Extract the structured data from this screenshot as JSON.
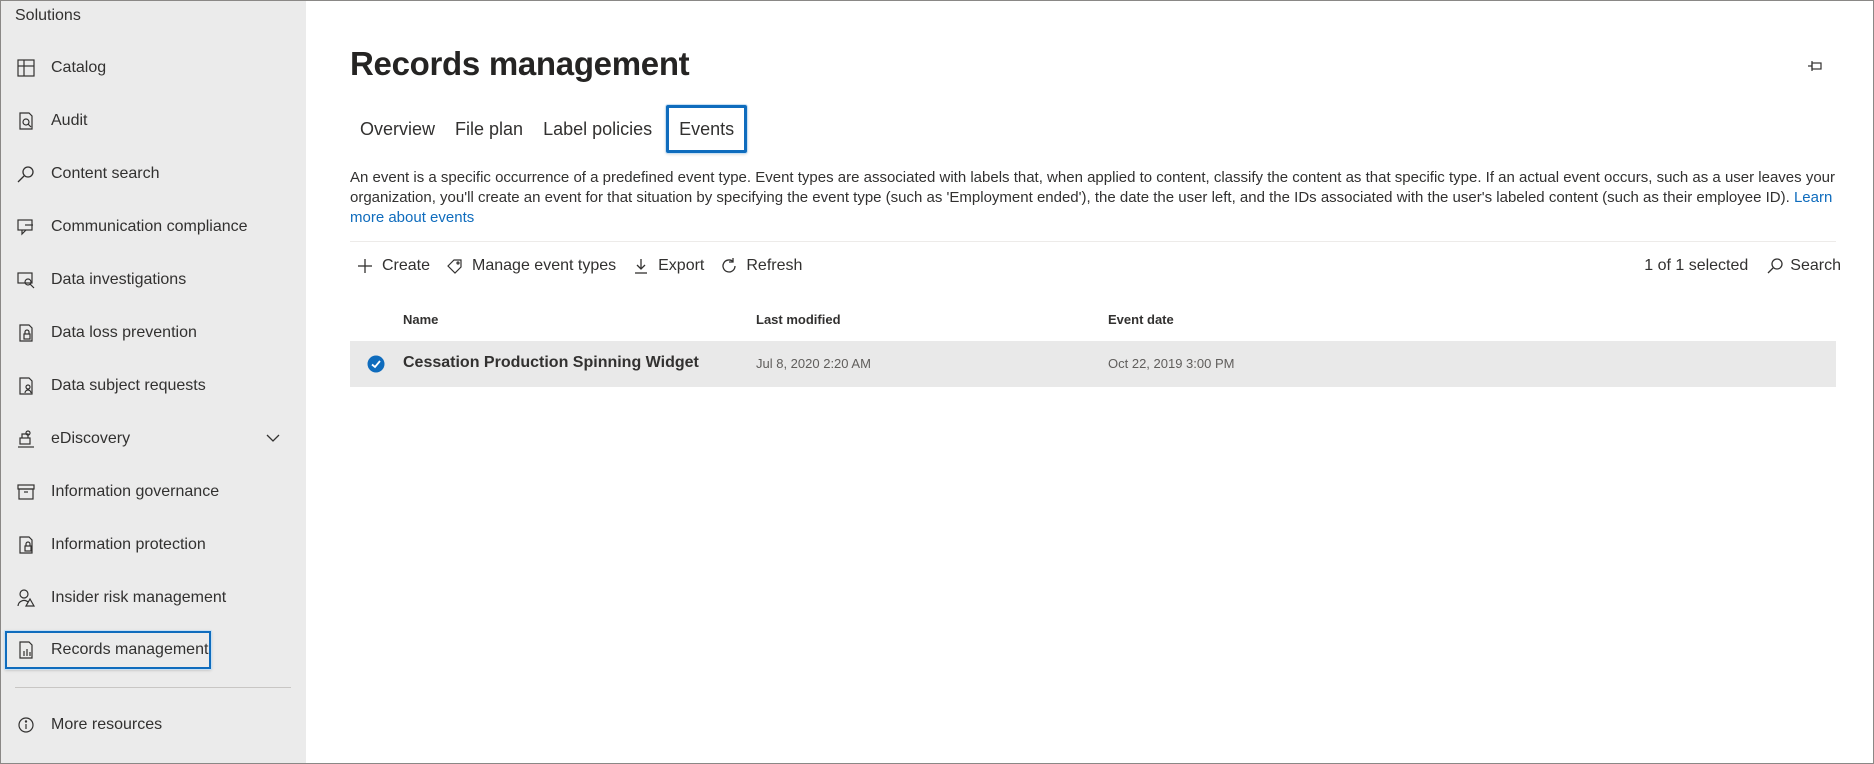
{
  "sidebar": {
    "heading": "Solutions",
    "items": [
      {
        "label": "Catalog",
        "icon": "catalog-icon"
      },
      {
        "label": "Audit",
        "icon": "audit-icon"
      },
      {
        "label": "Content search",
        "icon": "search-icon"
      },
      {
        "label": "Communication compliance",
        "icon": "chat-icon"
      },
      {
        "label": "Data investigations",
        "icon": "investigation-icon"
      },
      {
        "label": "Data loss prevention",
        "icon": "lock-document-icon"
      },
      {
        "label": "Data subject requests",
        "icon": "person-document-icon"
      },
      {
        "label": "eDiscovery",
        "icon": "ediscovery-icon"
      },
      {
        "label": "Information governance",
        "icon": "archive-icon"
      },
      {
        "label": "Information protection",
        "icon": "shield-document-icon"
      },
      {
        "label": "Insider risk management",
        "icon": "person-warning-icon"
      },
      {
        "label": "Records management",
        "icon": "records-icon"
      }
    ],
    "more": {
      "label": "More resources",
      "icon": "info-icon"
    }
  },
  "main": {
    "title": "Records management",
    "tabs": [
      {
        "label": "Overview"
      },
      {
        "label": "File plan"
      },
      {
        "label": "Label policies"
      },
      {
        "label": "Events"
      }
    ],
    "description": "An event is a specific occurrence of a predefined event type. Event types are associated with labels that, when applied to content, classify the content as that specific type. If an actual event occurs, such as a user leaves your organization, you'll create an event for that situation by specifying the event type (such as 'Employment ended'), the date the user left, and the IDs associated with the user's labeled content (such as their employee ID).",
    "learn_more": "Learn more about events",
    "toolbar": {
      "create": "Create",
      "manage": "Manage event types",
      "export": "Export",
      "refresh": "Refresh",
      "selected": "1 of 1 selected",
      "search": "Search"
    },
    "table": {
      "headers": {
        "name": "Name",
        "last_modified": "Last modified",
        "event_date": "Event date"
      },
      "rows": [
        {
          "name": "Cessation Production Spinning Widget",
          "last_modified": "Jul 8, 2020 2:20 AM",
          "event_date": "Oct 22, 2019 3:00 PM"
        }
      ]
    }
  },
  "colors": {
    "accent": "#0f6cbd",
    "sidebar_bg": "#ebebeb",
    "row_selected": "#e9e9e9"
  }
}
